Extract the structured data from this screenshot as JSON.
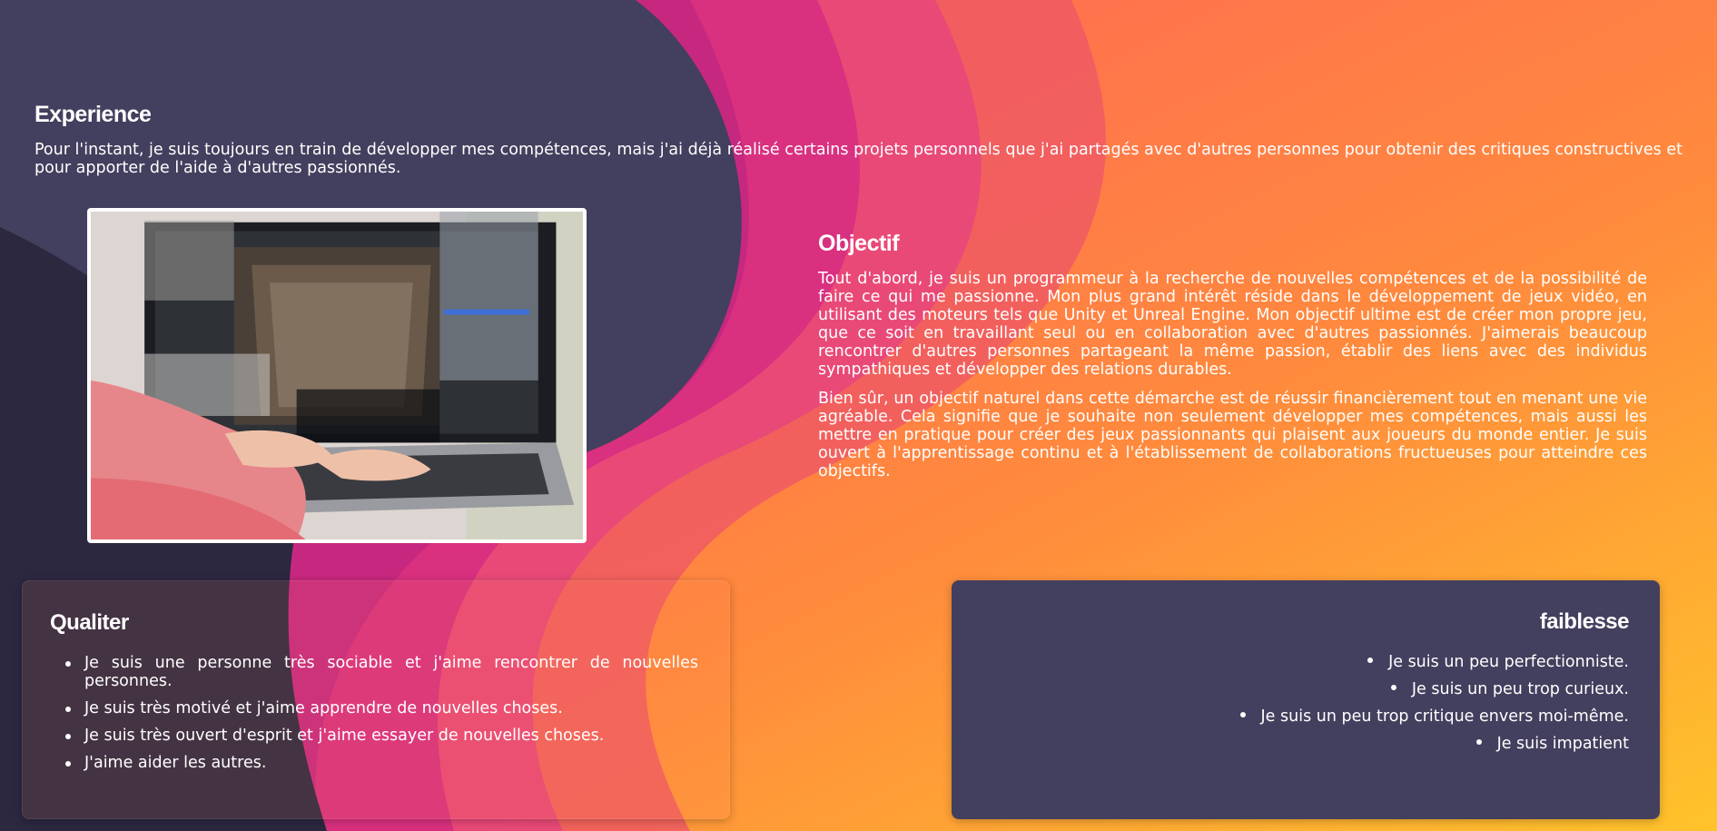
{
  "experience": {
    "title": "Experience",
    "text": "Pour l'instant, je suis toujours en train de développer mes compétences, mais j'ai déjà réalisé certains projets personnels que j'ai partagés avec d'autres personnes pour obtenir des critiques constructives et pour apporter de l'aide à d'autres passionnés."
  },
  "photo": {
    "icon": "laptop-coding-photo"
  },
  "objectif": {
    "title": "Objectif",
    "paragraphs": [
      "Tout d'abord, je suis un programmeur à la recherche de nouvelles compétences et de la possibilité de faire ce qui me passionne. Mon plus grand intérêt réside dans le développement de jeux vidéo, en utilisant des moteurs tels que Unity et Unreal Engine. Mon objectif ultime est de créer mon propre jeu, que ce soit en travaillant seul ou en collaboration avec d'autres passionnés. J'aimerais beaucoup rencontrer d'autres personnes partageant la même passion, établir des liens avec des individus sympathiques et développer des relations durables.",
      "Bien sûr, un objectif naturel dans cette démarche est de réussir financièrement tout en menant une vie agréable. Cela signifie que je souhaite non seulement développer mes compétences, mais aussi les mettre en pratique pour créer des jeux passionnants qui plaisent aux joueurs du monde entier. Je suis ouvert à l'apprentissage continu et à l'établissement de collaborations fructueuses pour atteindre ces objectifs."
    ]
  },
  "qualiter": {
    "title": "Qualiter",
    "items": [
      "Je suis une personne très sociable et j'aime rencontrer de nouvelles personnes.",
      "Je suis très motivé et j'aime apprendre de nouvelles choses.",
      "Je suis très ouvert d'esprit et j'aime essayer de nouvelles choses.",
      "J'aime aider les autres."
    ]
  },
  "faiblesse": {
    "title": "faiblesse",
    "items": [
      "Je suis un peu perfectionniste.",
      "Je suis un peu trop curieux.",
      "Je suis un peu trop critique envers moi-même.",
      "Je suis impatient"
    ]
  },
  "colors": {
    "dark": "#2b2840",
    "magenta": "#d62a7e",
    "coral": "#ff5a5f",
    "orange": "#ff8a3d",
    "yellow": "#ffc32b",
    "card_dark": "#433f5e"
  }
}
